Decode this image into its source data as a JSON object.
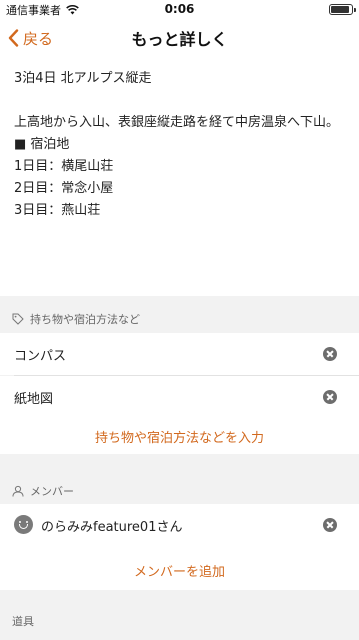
{
  "status_bar": {
    "carrier": "通信事業者",
    "time": "0:06",
    "battery_level": 0.9
  },
  "nav": {
    "back_label": "戻る",
    "title": "もっと詳しく"
  },
  "description": {
    "title_line": "3泊4日 北アルプス縦走",
    "summary": "上高地から入山、表銀座縦走路を経て中房温泉へ下山。",
    "lodging_header": "■ 宿泊地",
    "days": [
      "1日目：横尾山荘",
      "2日目：常念小屋",
      "3日目：燕山荘"
    ]
  },
  "items_section": {
    "header": "持ち物や宿泊方法など",
    "items": [
      {
        "label": "コンパス"
      },
      {
        "label": "紙地図"
      }
    ],
    "add_label": "持ち物や宿泊方法などを入力"
  },
  "members_section": {
    "header": "メンバー",
    "members": [
      {
        "name": "のらみみfeature01さん"
      }
    ],
    "add_label": "メンバーを追加"
  },
  "tools_section": {
    "header": "道具"
  },
  "colors": {
    "accent": "#d2691e",
    "section_background": "#f2f2f2",
    "remove_icon": "#6d6d6d"
  }
}
